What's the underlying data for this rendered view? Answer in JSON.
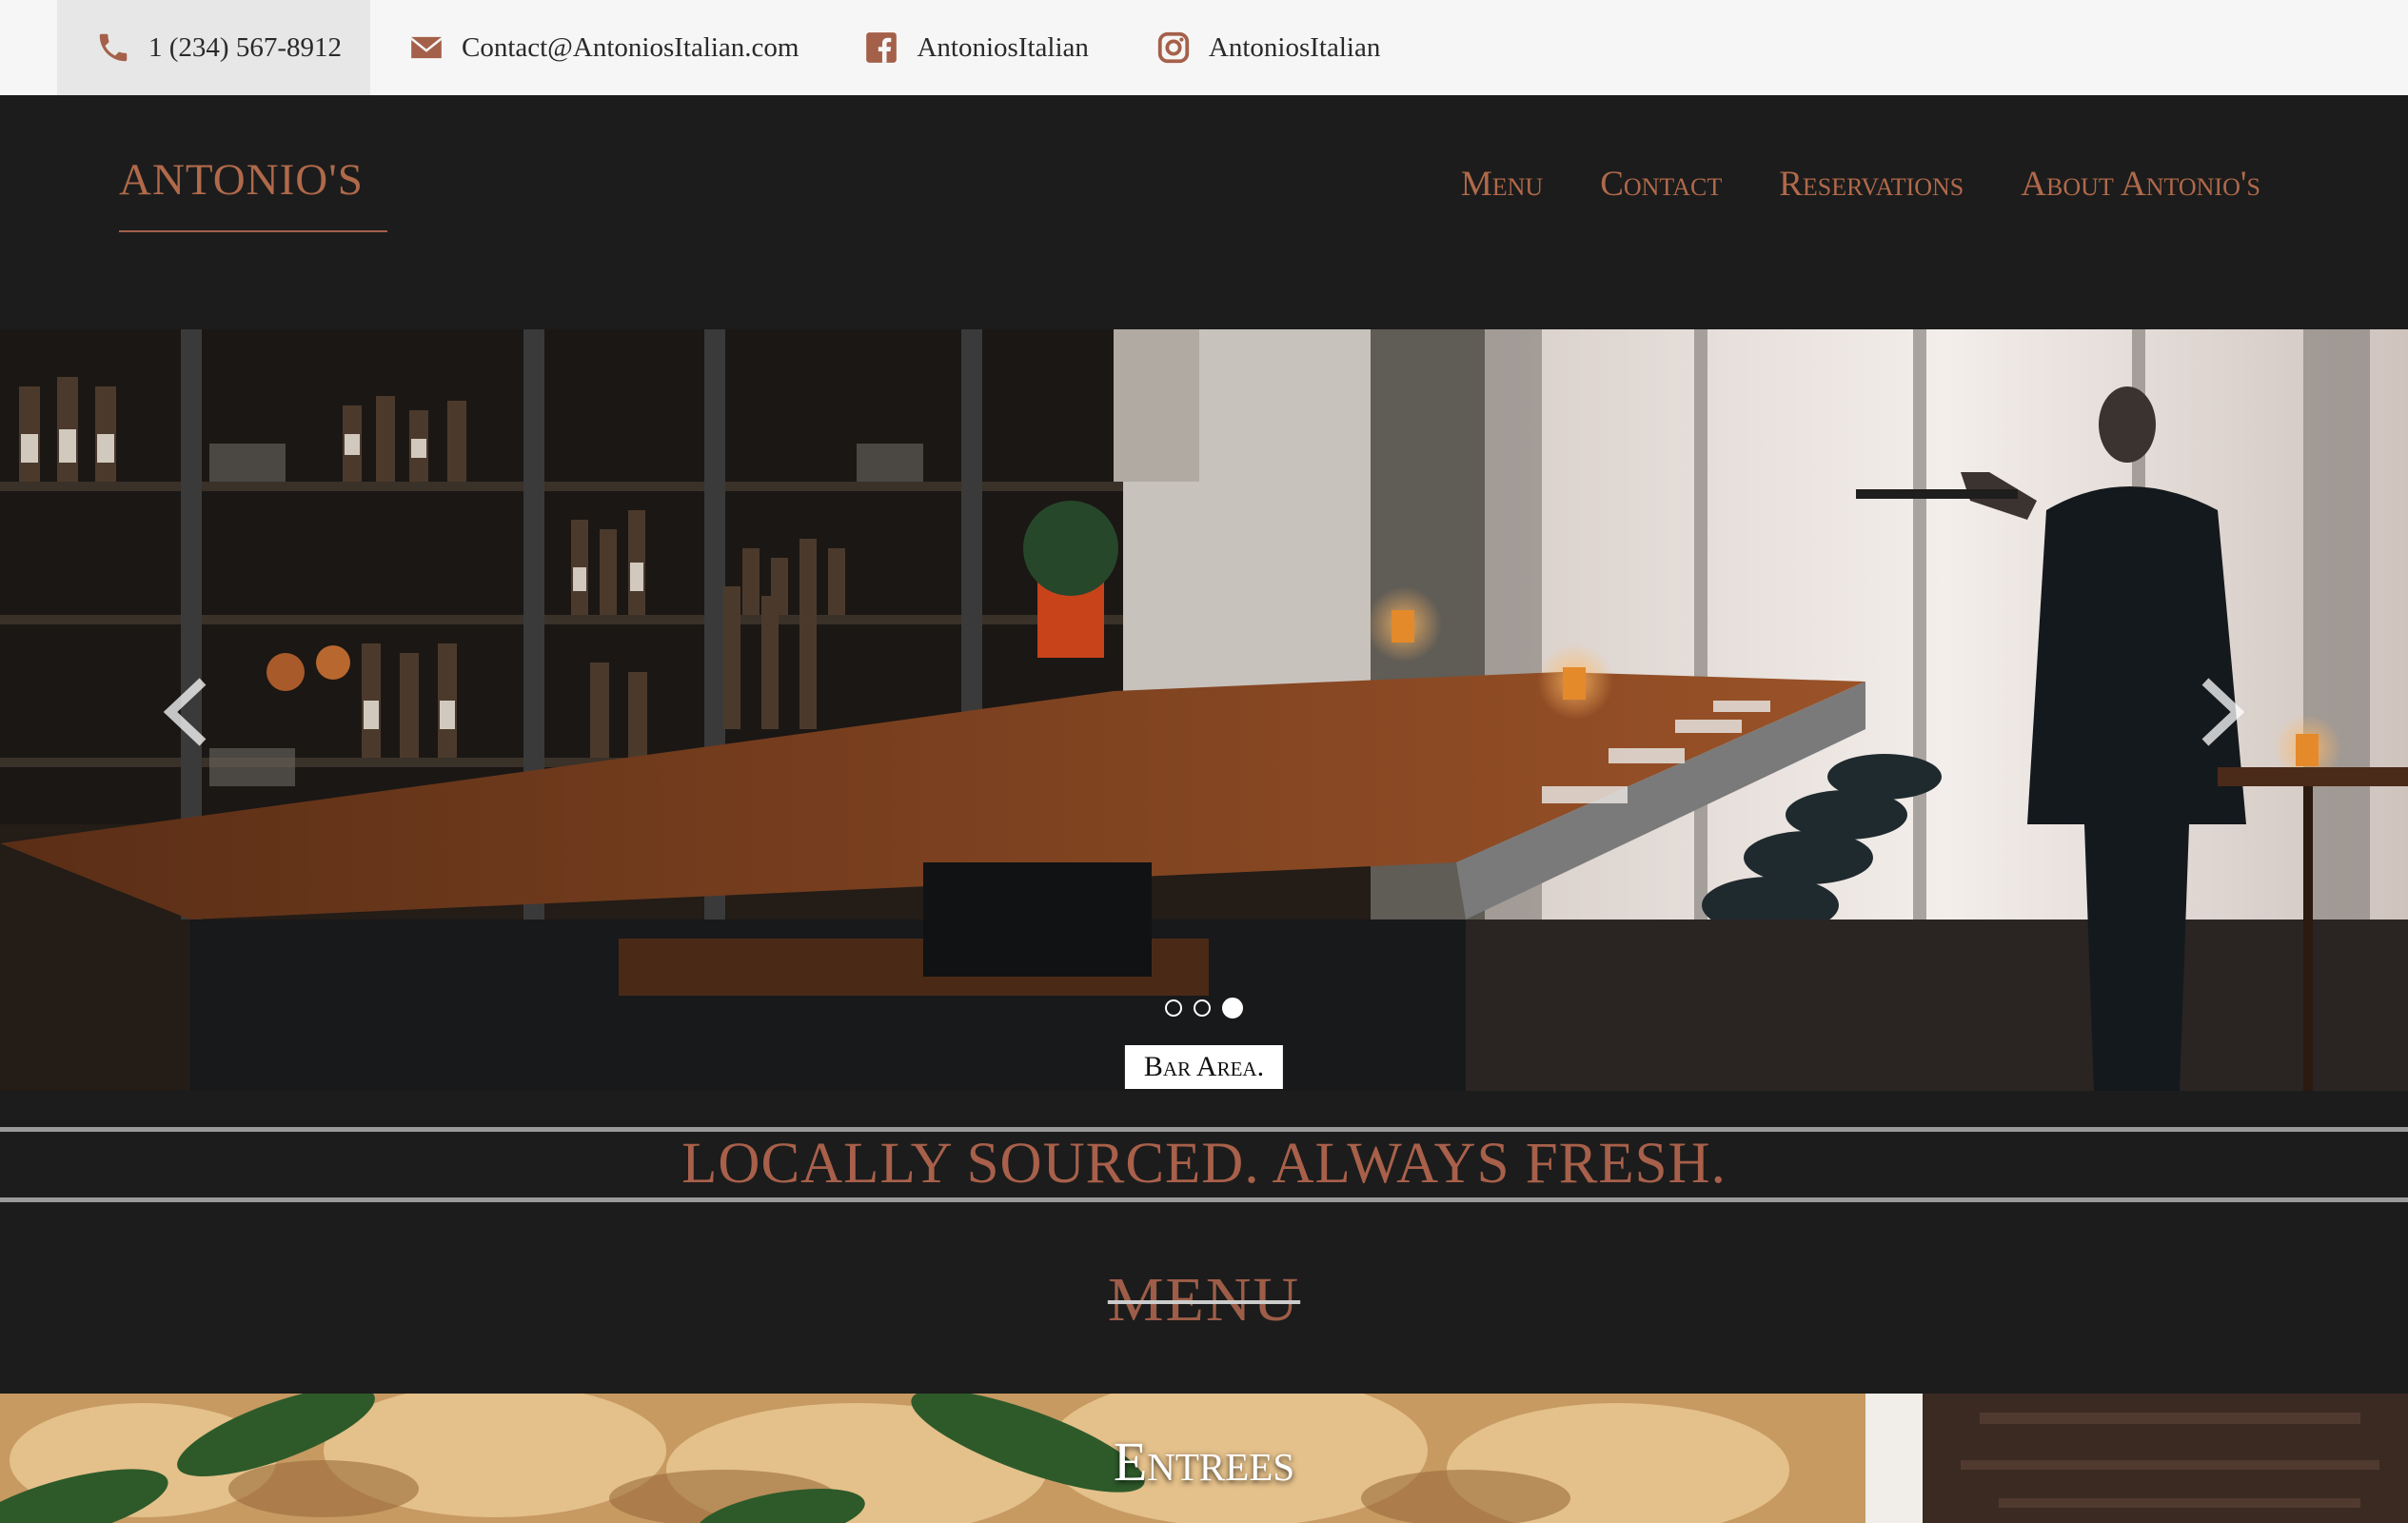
{
  "topbar": {
    "phone": "1 (234) 567-8912",
    "email": "Contact@AntoniosItalian.com",
    "facebook": "AntoniosItalian",
    "instagram": "AntoniosItalian",
    "icons": [
      "phone-icon",
      "envelope-icon",
      "facebook-icon",
      "instagram-icon"
    ]
  },
  "nav": {
    "logo": "ANTONIO'S",
    "items": [
      "Menu",
      "Contact",
      "Reservations",
      "About Antonio's"
    ]
  },
  "carousel": {
    "caption": "Bar Area.",
    "slide_count": 3,
    "active_slide": 3
  },
  "tagline": "LOCALLY SOURCED. ALWAYS FRESH.",
  "menu_heading": "MENU",
  "entrees": {
    "title": "Entrees"
  },
  "colors": {
    "accent": "#b0694a",
    "background": "#1c1c1c",
    "topbar": "#f6f6f6"
  }
}
